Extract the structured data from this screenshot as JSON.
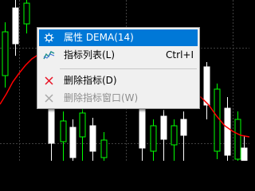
{
  "colors": {
    "background": "#000000",
    "bull_candle": "#00ff00",
    "bear_candle": "#ffffff",
    "indicator_line": "#ff0000",
    "grid": "#404040",
    "menu_bg": "#f0f0f0",
    "menu_highlight": "#0078d7",
    "disabled_text": "#8d8d8d",
    "delete_icon": "#e81123"
  },
  "context_menu": {
    "items": [
      {
        "label": "属性 DEMA(14)",
        "shortcut": "",
        "icon": "gear-icon",
        "state": "highlighted"
      },
      {
        "label": "指标列表(L)",
        "shortcut": "Ctrl+I",
        "icon": "indicator-list-icon",
        "state": "normal"
      },
      {
        "label": "删除指标(D)",
        "shortcut": "",
        "icon": "delete-x-icon",
        "state": "normal"
      },
      {
        "label": "删除指标窗口(W)",
        "shortcut": "",
        "icon": "delete-x-gray-icon",
        "state": "disabled"
      }
    ]
  }
}
